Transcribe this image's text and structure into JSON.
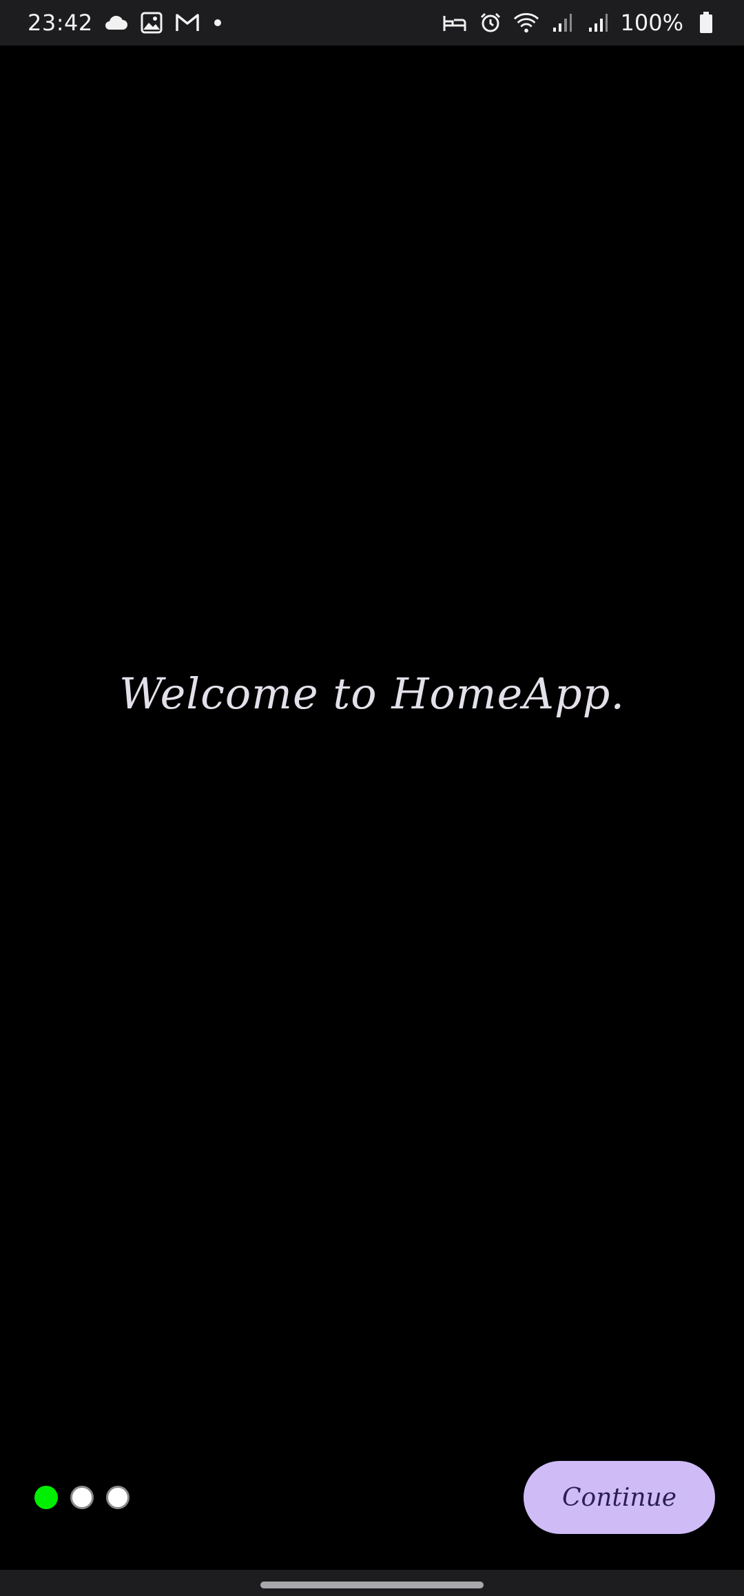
{
  "status_bar": {
    "time": "23:42",
    "battery_percent": "100%",
    "left_icons": [
      "cloud-icon",
      "gallery-icon",
      "gmail-icon",
      "notification-dot"
    ],
    "right_icons": [
      "bed-icon",
      "alarm-icon",
      "wifi-icon",
      "signal-icon",
      "signal-icon",
      "battery-icon"
    ]
  },
  "main": {
    "welcome_text": "Welcome to HomeApp."
  },
  "pager": {
    "total_pages": 3,
    "current_page": 1,
    "active_color": "#00ee00"
  },
  "actions": {
    "continue_label": "Continue",
    "button_color": "#cfbcf7"
  }
}
